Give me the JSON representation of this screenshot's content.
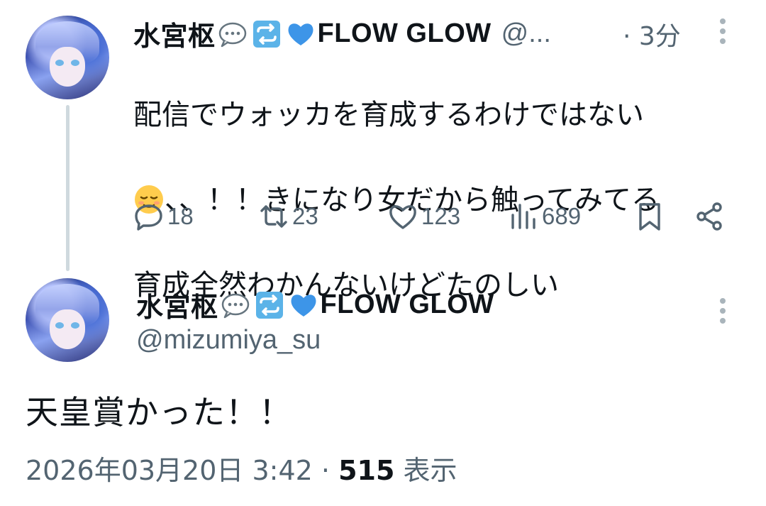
{
  "reply_tweet": {
    "display_name": "水宮枢",
    "name_suffix": "FLOW GLOW",
    "handle_truncated": "@...",
    "time": "· 3分",
    "text_line1": "配信でウォッカを育成するわけではない",
    "text_line2_after_emoji": "、、！！きになり女だから触ってみてる",
    "text_line3": "育成全然わかんないけどたのしい",
    "icons": [
      "reply-icon",
      "retweet-icon",
      "like-icon",
      "views-icon",
      "bookmark-icon",
      "share-icon"
    ],
    "counts": {
      "replies": "18",
      "retweets": "23",
      "likes": "123",
      "views": "689"
    }
  },
  "main_tweet": {
    "display_name": "水宮枢",
    "name_suffix": "FLOW GLOW",
    "handle": "@mizumiya_su",
    "text": "天皇賞かった！！",
    "date": "2026年03月20日 3:42",
    "separator": " · ",
    "views_count": "515",
    "views_label": " 表示"
  },
  "colors": {
    "text_primary": "#0f1419",
    "text_secondary": "#536471",
    "thread_line": "#cfd9de",
    "retweet_emoji_bg": "#5bb3e8",
    "heart_blue": "#3d95e8"
  }
}
